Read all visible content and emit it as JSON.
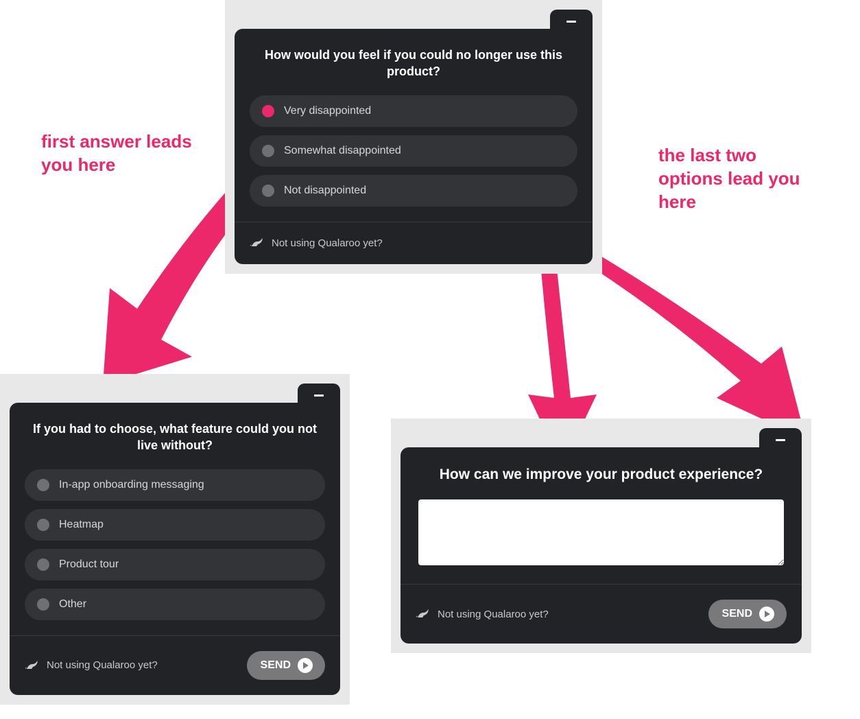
{
  "annotations": {
    "left": "first answer leads you here",
    "right": "the last two options lead you here"
  },
  "footer": {
    "prompt_text": "Not using Qualaroo yet?",
    "send_label": "SEND"
  },
  "surveys": {
    "top": {
      "question": "How would you feel if you could no longer use this product?",
      "options": [
        "Very disappointed",
        "Somewhat disappointed",
        "Not disappointed"
      ],
      "selected_index": 0
    },
    "bottom_left": {
      "question": "If you had to choose, what feature could you not live without?",
      "options": [
        "In-app onboarding messaging",
        "Heatmap",
        "Product tour",
        "Other"
      ]
    },
    "bottom_right": {
      "question": "How can we improve your product experience?",
      "textarea_value": ""
    }
  },
  "branching": {
    "first_option_leads_to": "bottom_left",
    "last_two_options_lead_to": "bottom_right"
  },
  "colors": {
    "accent_pink": "#ec276a",
    "card_bg": "#222326",
    "option_bg": "#333438"
  }
}
